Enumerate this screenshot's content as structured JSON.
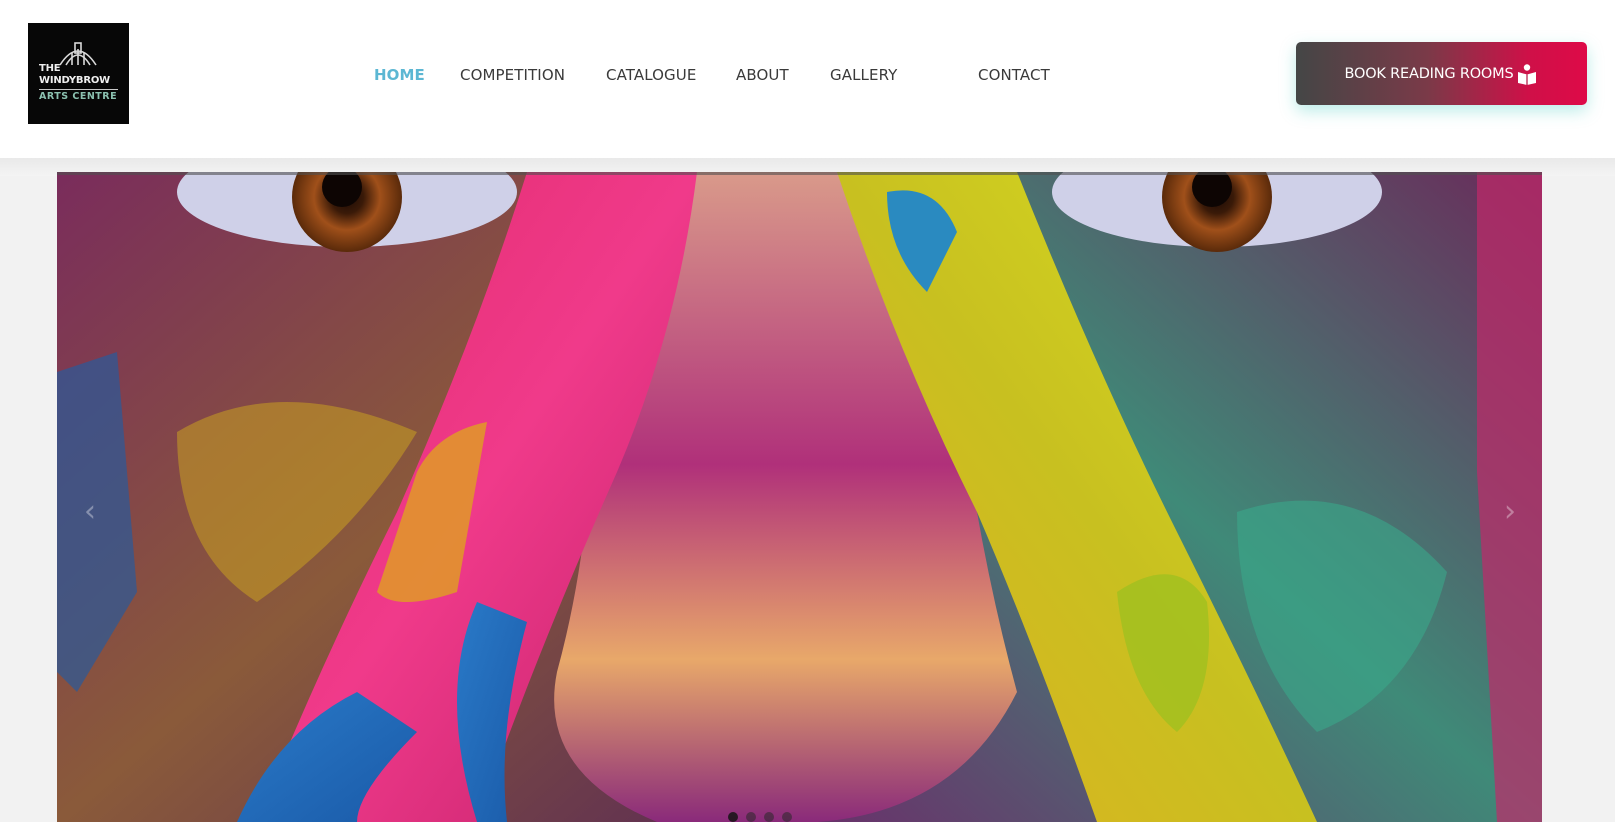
{
  "logo": {
    "line1": "THE",
    "line2": "WINDYBROW",
    "line3": "ARTS CENTRE",
    "icon": "windybrow-building-logo"
  },
  "nav": {
    "items": [
      {
        "label": "HOME",
        "active": true
      },
      {
        "label": "COMPETITION",
        "active": false
      },
      {
        "label": "CATALOGUE",
        "active": false
      },
      {
        "label": "ABOUT",
        "active": false
      },
      {
        "label": "GALLERY",
        "active": false
      },
      {
        "label": "CONTACT",
        "active": false
      }
    ]
  },
  "cta": {
    "label": "BOOK READING ROOMS",
    "icon": "reader-book-icon"
  },
  "hero": {
    "image": "colorful-painted-face-hands-photo",
    "prev_icon": "chevron-left-icon",
    "next_icon": "chevron-right-icon",
    "slides_count": 4,
    "active_slide": 1
  },
  "colors": {
    "active_nav": "#5cb7d3",
    "nav_text": "#3a3a3a",
    "cta_start": "#444646",
    "cta_end": "#de0a48",
    "header_bg": "#ffffff",
    "page_bg": "#f2f2f2"
  }
}
